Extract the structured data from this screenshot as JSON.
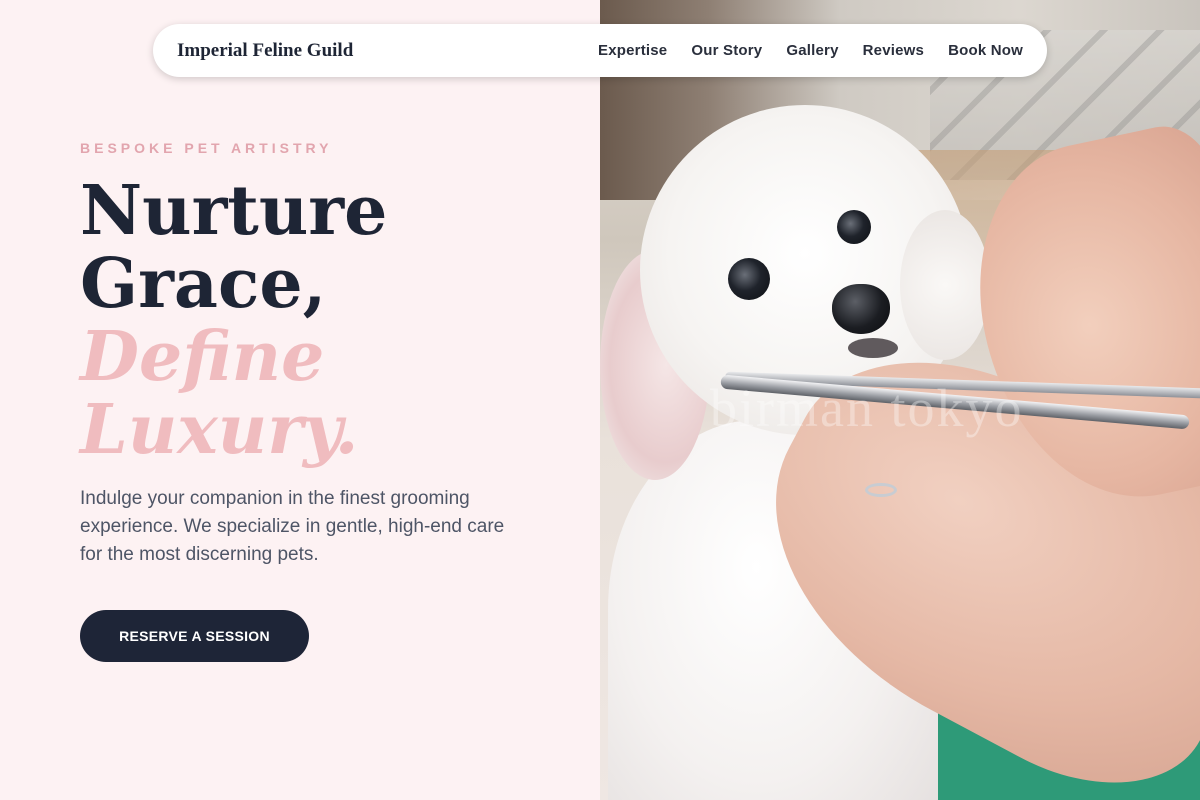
{
  "nav": {
    "brand": "Imperial Feline Guild",
    "links": [
      "Expertise",
      "Our Story",
      "Gallery",
      "Reviews",
      "Book Now"
    ]
  },
  "hero": {
    "eyebrow": "BESPOKE PET ARTISTRY",
    "headline": [
      "Nurture",
      "Grace,"
    ],
    "headline_accent": [
      "Define",
      "Luxury."
    ],
    "subtext": "Indulge your companion in the finest grooming experience. We specialize in gentle, high-end care for the most discerning pets.",
    "cta_label": "RESERVE A SESSION"
  },
  "photo": {
    "watermark": "birman tokyo"
  },
  "colors": {
    "background": "#fdf2f3",
    "navy": "#1e2537",
    "accent_pink": "#f0bcbf"
  }
}
